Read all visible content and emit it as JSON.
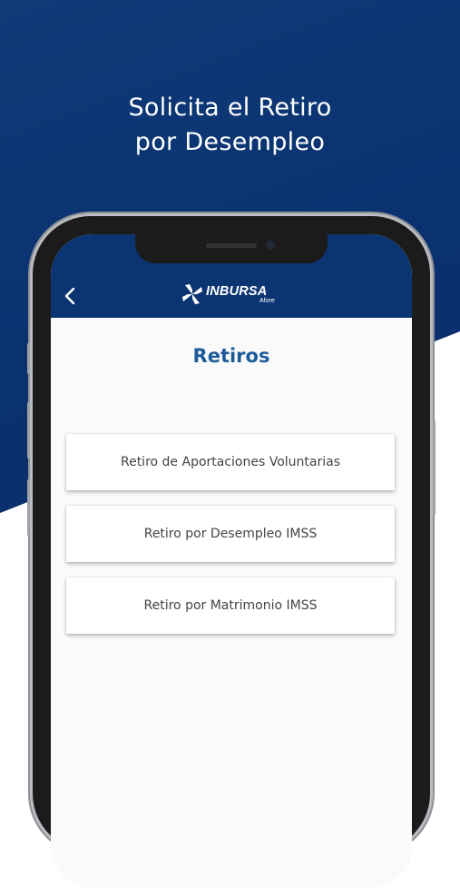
{
  "promo": {
    "headline_line1": "Solicita el Retiro",
    "headline_line2": "por Desempleo"
  },
  "app": {
    "brand": {
      "name": "INBURSA",
      "sub": "Afore"
    },
    "back_icon": "chevron-left-icon",
    "page_title": "Retiros",
    "options": [
      {
        "label": "Retiro de Aportaciones Voluntarias"
      },
      {
        "label": "Retiro por Desempleo IMSS"
      },
      {
        "label": "Retiro por Matrimonio IMSS"
      }
    ]
  },
  "colors": {
    "brand_blue": "#0b3572",
    "title_blue": "#1d5c9a",
    "background_white": "#ffffff"
  }
}
